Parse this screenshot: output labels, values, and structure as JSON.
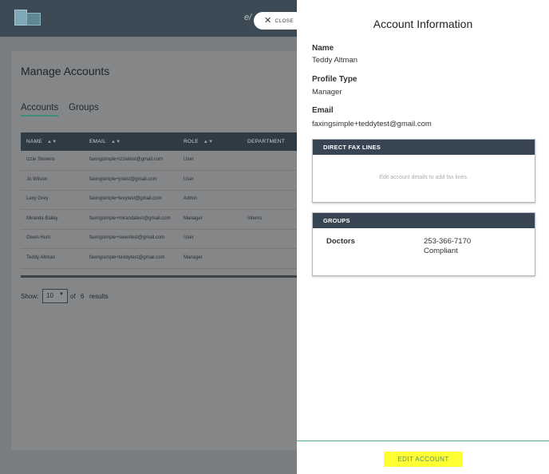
{
  "header": {
    "close_label": "CLOSE"
  },
  "page": {
    "title": "Manage Accounts",
    "tabs": [
      {
        "label": "Accounts",
        "active": true
      },
      {
        "label": "Groups",
        "active": false
      }
    ]
  },
  "table": {
    "columns": [
      "NAME",
      "EMAIL",
      "ROLE",
      "DEPARTMENT"
    ],
    "rows": [
      {
        "name": "Izzie Stevens",
        "email": "faxingsimple+izzietest@gmail.com",
        "role": "User",
        "department": ""
      },
      {
        "name": "Jo Wilson",
        "email": "faxingsimple+jotest@gmail.com",
        "role": "User",
        "department": ""
      },
      {
        "name": "Lexy Grey",
        "email": "faxingsimple+lexytest@gmail.com",
        "role": "Admin",
        "department": ""
      },
      {
        "name": "Miranda Bailey",
        "email": "faxingsimple+mirandatest@gmail.com",
        "role": "Manager",
        "department": "Interns"
      },
      {
        "name": "Owen Hunt",
        "email": "faxingsimple+owentest@gmail.com",
        "role": "User",
        "department": ""
      },
      {
        "name": "Teddy Altman",
        "email": "faxingsimple+teddytest@gmail.com",
        "role": "Manager",
        "department": ""
      }
    ]
  },
  "pagination": {
    "show_label": "Show:",
    "page_size": "10",
    "of_label": "of",
    "total": "6",
    "results_label": "results"
  },
  "panel": {
    "title": "Account Information",
    "name_label": "Name",
    "name_value": "Teddy Altman",
    "profile_type_label": "Profile Type",
    "profile_type_value": "Manager",
    "email_label": "Email",
    "email_value": "faxingsimple+teddytest@gmail.com",
    "fax_lines_header": "DIRECT FAX LINES",
    "fax_lines_empty": "Edit account details to add fax lines.",
    "groups_header": "GROUPS",
    "groups": [
      {
        "name": "Doctors",
        "phone": "253-366-7170",
        "status": "Compliant"
      }
    ],
    "edit_button": "EDIT ACCOUNT"
  },
  "colors": {
    "topbar": "#3b4a55",
    "table_header": "#2f3b44",
    "box_header": "#374452",
    "accent": "#3f8a78",
    "highlight": "#ffff33"
  }
}
